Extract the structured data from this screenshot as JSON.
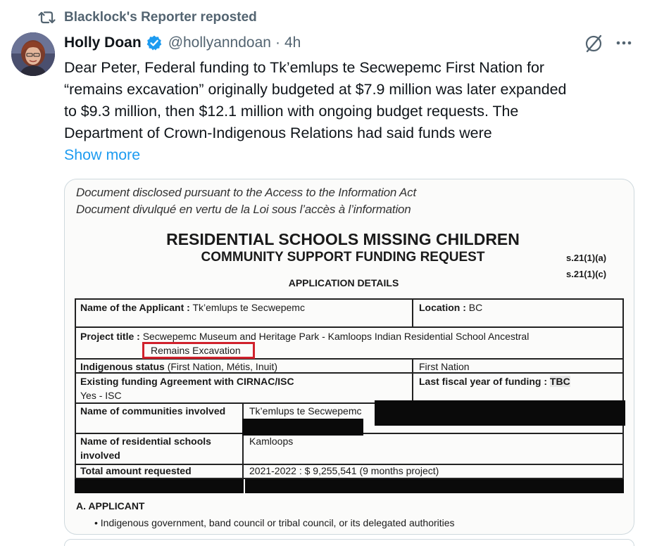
{
  "repost": {
    "label": "Blacklock's Reporter reposted",
    "icon": "repost-icon"
  },
  "author": {
    "display_name": "Holly Doan",
    "handle": "@hollyanndoan",
    "separator": "·",
    "time": "4h",
    "verified_icon": "verified-badge-icon",
    "avatar": "avatar"
  },
  "actions": {
    "grok_icon": "grok-icon",
    "more_icon": "more-icon"
  },
  "tweet": {
    "lines": [
      "Dear Peter, Federal funding to Tk’emlups te Secwepemc First Nation for",
      "“remains excavation” originally budgeted at $7.9 million was later expanded",
      "to $9.3 million, then $12.1 million with ongoing budget requests. The",
      "Department of Crown-Indigenous Relations had said funds were"
    ],
    "show_more": "Show more"
  },
  "document": {
    "disclosure_en": "Document disclosed pursuant to the Access to the Information Act",
    "disclosure_fr": "Document divulqué en vertu de la Loi sous l’accès à l’information",
    "title_line1": "RESIDENTIAL SCHOOLS MISSING CHILDREN",
    "title_line2": "COMMUNITY SUPPORT FUNDING REQUEST",
    "section_code1": "s.21(1)(a)",
    "section_code2": "s.21(1)(c)",
    "subheading": "APPLICATION DETAILS",
    "form": {
      "applicant_label": "Name of the Applicant :",
      "applicant_value": "Tk’emlups te Secwepemc",
      "location_label": "Location :",
      "location_value": "BC",
      "project_label": "Project title :",
      "project_value_line1": "Secwepemc Museum and Heritage Park - Kamloops Indian Residential School Ancestral",
      "project_value_line2": "Remains Excavation",
      "indigenous_label": "Indigenous status",
      "indigenous_hint": "(First Nation, Métis, Inuit)",
      "indigenous_value": "First Nation",
      "existing_label": "Existing funding Agreement with CIRNAC/ISC",
      "existing_value": "Yes - ISC",
      "last_fiscal_label": "Last fiscal year of funding :",
      "last_fiscal_value": "TBC",
      "communities_label": "Name of communities involved",
      "communities_value": "Tk’emlups te Secwepemc",
      "schools_label_line1": "Name of residential schools",
      "schools_label_line2": "involved",
      "schools_value": "Kamloops",
      "total_label": "Total amount requested",
      "total_value": "2021-2022 : $ 9,255,541 (9 months project)"
    },
    "section_a": "A.   APPLICANT",
    "bullet": "•    Indigenous government, band council or tribal council, or its delegated authorities"
  }
}
